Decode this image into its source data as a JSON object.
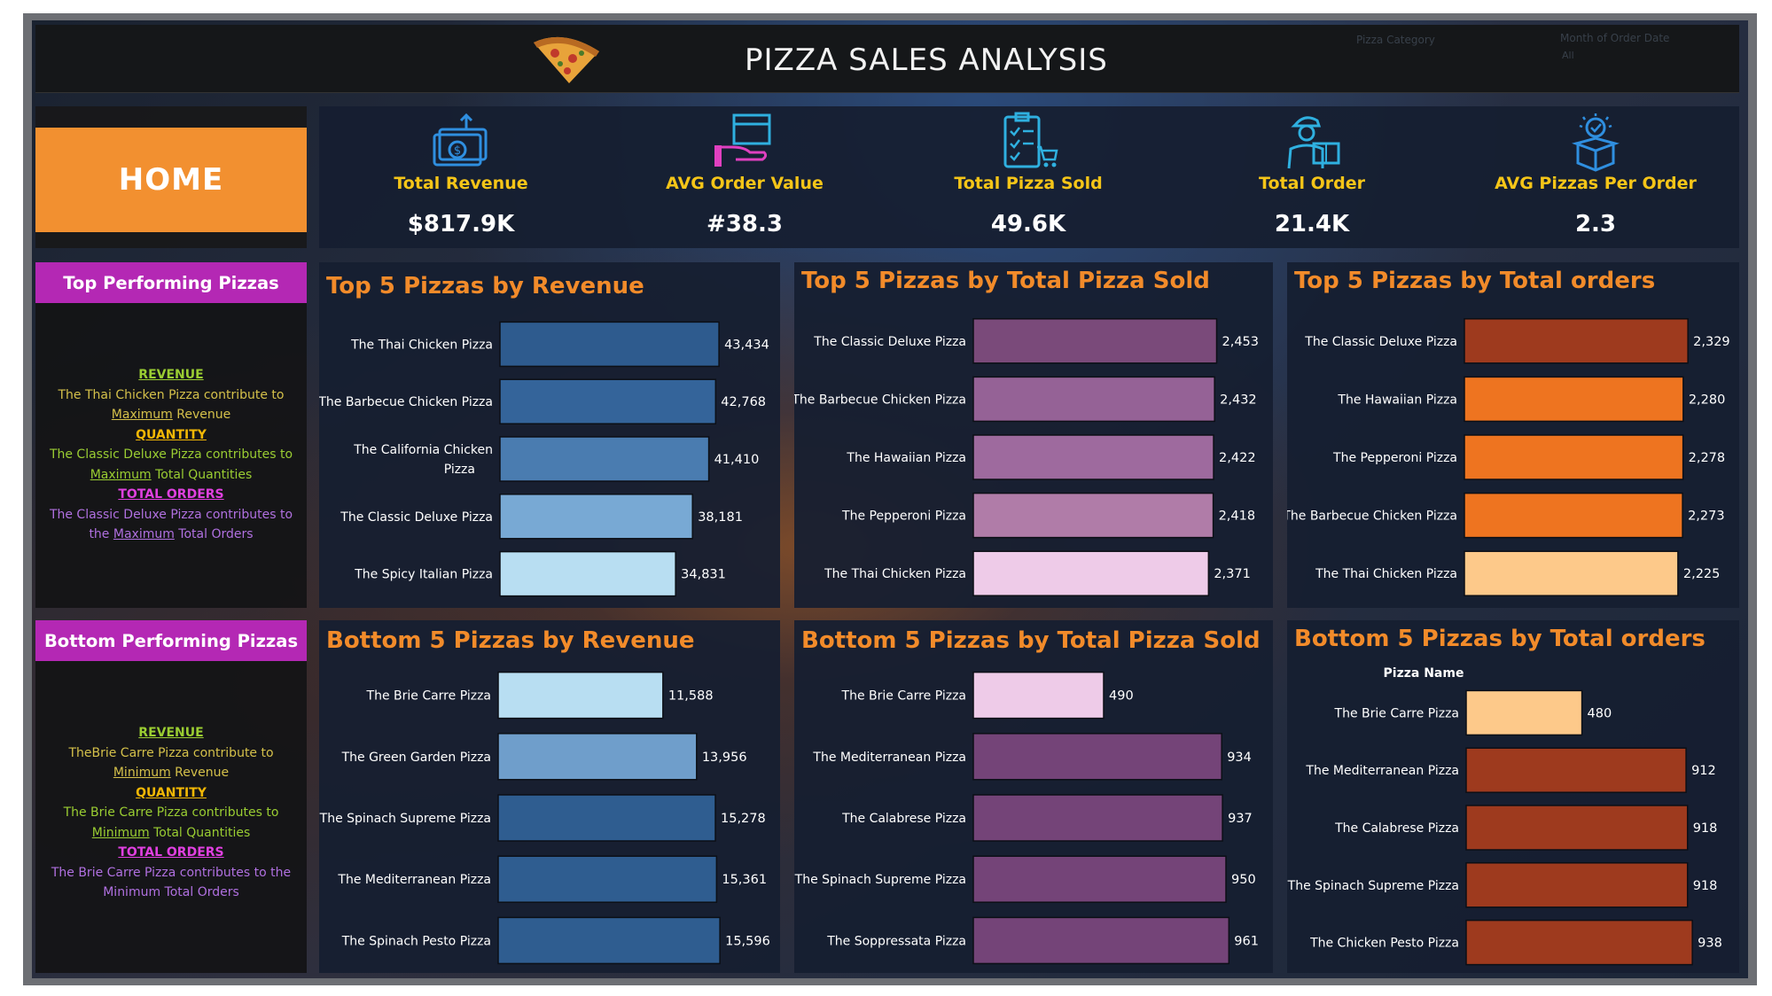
{
  "header": {
    "title": "PIZZA SALES ANALYSIS",
    "faint_label_1": "Pizza Category",
    "faint_label_2": "Month of Order Date",
    "faint_value_2": "All"
  },
  "home_button": {
    "label": "HOME"
  },
  "kpis": [
    {
      "label": "Total Revenue",
      "value": "$817.9K",
      "icon": "money-icon"
    },
    {
      "label": "AVG Order Value",
      "value": "#38.3",
      "icon": "hand-box-icon"
    },
    {
      "label": "Total Pizza Sold",
      "value": "49.6K",
      "icon": "checklist-cart-icon"
    },
    {
      "label": "Total Order",
      "value": "21.4K",
      "icon": "delivery-person-icon"
    },
    {
      "label": "AVG Pizzas Per Order",
      "value": "2.3",
      "icon": "open-box-icon"
    }
  ],
  "top_section": {
    "heading": "Top Performing Pizzas",
    "revenue_hd": "REVENUE",
    "revenue_l1": "The Thai Chicken Pizza contribute to",
    "revenue_l2a": "Maximum",
    "revenue_l2b": " Revenue",
    "quantity_hd": "QUANTITY",
    "quantity_l1": "The Classic Deluxe Pizza contributes to",
    "quantity_l2a": "Maximum",
    "quantity_l2b": " Total Quantities",
    "orders_hd": "TOTAL ORDERS",
    "orders_l1": "The Classic Deluxe Pizza contributes to",
    "orders_l2a": "the ",
    "orders_l2b": "Maximum",
    "orders_l2c": " Total Orders"
  },
  "bottom_section": {
    "heading": "Bottom Performing Pizzas",
    "revenue_hd": "REVENUE",
    "revenue_l1": "TheBrie Carre Pizza contribute to",
    "revenue_l2a": "Minimum",
    "revenue_l2b": " Revenue",
    "quantity_hd": "QUANTITY",
    "quantity_l1": "The Brie Carre  Pizza contributes to",
    "quantity_l2a": "Minimum",
    "quantity_l2b": " Total Quantities",
    "orders_hd": "TOTAL ORDERS",
    "orders_l1": "The Brie Carre  Pizza contributes to the",
    "orders_l2": "Minimum Total Orders"
  },
  "colors": {
    "orange_title": "#f28b2a",
    "kpi_label": "#f5c518",
    "magenta": "#b428b4",
    "green_note": "#9acd32",
    "yellow_note": "#d4c04a",
    "purple_note": "#b070e0"
  },
  "chart_data": [
    {
      "type": "bar",
      "orientation": "horizontal",
      "title": "Top 5 Pizzas by Revenue",
      "categories": [
        "The Thai Chicken Pizza",
        "The Barbecue Chicken Pizza",
        "The California Chicken Pizza",
        "The Classic Deluxe Pizza",
        "The Spicy Italian Pizza"
      ],
      "values": [
        43434,
        42768,
        41410,
        38181,
        34831
      ],
      "labels": [
        "43,434",
        "42,768",
        "41,410",
        "38,181",
        "34,831"
      ],
      "colors": [
        "#2e5b8e",
        "#34649a",
        "#4a7cb0",
        "#78a9d4",
        "#b8def2"
      ],
      "xlim": [
        0,
        45000
      ]
    },
    {
      "type": "bar",
      "orientation": "horizontal",
      "title": "Top 5 Pizzas by Total Pizza Sold",
      "categories": [
        "The Classic Deluxe Pizza",
        "The Barbecue Chicken Pizza",
        "The Hawaiian Pizza",
        "The Pepperoni Pizza",
        "The Thai Chicken Pizza"
      ],
      "values": [
        2453,
        2432,
        2422,
        2418,
        2371
      ],
      "labels": [
        "2,453",
        "2,432",
        "2,422",
        "2,418",
        "2,371"
      ],
      "colors": [
        "#7a4a7a",
        "#956296",
        "#9e6a9e",
        "#b07ca8",
        "#eecbe8"
      ],
      "xlim": [
        0,
        2520
      ]
    },
    {
      "type": "bar",
      "orientation": "horizontal",
      "title": "Top 5 Pizzas by Total orders",
      "categories": [
        "The Classic Deluxe Pizza",
        "The Hawaiian Pizza",
        "The Pepperoni Pizza",
        "The Barbecue Chicken Pizza",
        "The Thai Chicken Pizza"
      ],
      "values": [
        2329,
        2280,
        2278,
        2273,
        2225
      ],
      "labels": [
        "2,329",
        "2,280",
        "2,278",
        "2,273",
        "2,225"
      ],
      "colors": [
        "#9e3a1e",
        "#ee7420",
        "#ee7420",
        "#ee7420",
        "#fdc98a"
      ],
      "xlim": [
        0,
        2420
      ]
    },
    {
      "type": "bar",
      "orientation": "horizontal",
      "title": "Bottom 5 Pizzas by Revenue",
      "categories": [
        "The Brie Carre Pizza",
        "The Green Garden Pizza",
        "The Spinach Supreme Pizza",
        "The Mediterranean Pizza",
        "The Spinach Pesto Pizza"
      ],
      "values": [
        11588,
        13956,
        15278,
        15361,
        15596
      ],
      "labels": [
        "11,588",
        "13,956",
        "15,278",
        "15,361",
        "15,596"
      ],
      "colors": [
        "#b8def2",
        "#6f9ecb",
        "#2f5d90",
        "#2f5d90",
        "#2f5d90"
      ],
      "xlim": [
        0,
        16150
      ]
    },
    {
      "type": "bar",
      "orientation": "horizontal",
      "title": "Bottom 5 Pizzas by Total Pizza Sold",
      "categories": [
        "The Brie Carre Pizza",
        "The Mediterranean Pizza",
        "The Calabrese Pizza",
        "The Spinach Supreme Pizza",
        "The Soppressata Pizza"
      ],
      "values": [
        490,
        934,
        937,
        950,
        961
      ],
      "labels": [
        "490",
        "934",
        "937",
        "950",
        "961"
      ],
      "colors": [
        "#eecbe8",
        "#744478",
        "#744478",
        "#744478",
        "#744478"
      ],
      "xlim": [
        0,
        980
      ]
    },
    {
      "type": "bar",
      "orientation": "horizontal",
      "title": "Bottom 5 Pizzas by Total orders",
      "column_header": "Pizza Name",
      "categories": [
        "The Brie Carre Pizza",
        "The Mediterranean Pizza",
        "The Calabrese Pizza",
        "The Spinach Supreme Pizza",
        "The Chicken Pesto Pizza"
      ],
      "values": [
        480,
        912,
        918,
        918,
        938
      ],
      "labels": [
        "480",
        "912",
        "918",
        "918",
        "938"
      ],
      "colors": [
        "#fdc98a",
        "#9e3a1e",
        "#9e3a1e",
        "#9e3a1e",
        "#9e3a1e"
      ],
      "xlim": [
        0,
        1000
      ]
    }
  ]
}
